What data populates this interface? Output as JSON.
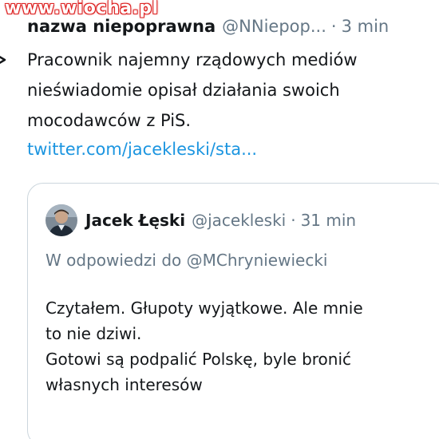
{
  "watermark": {
    "text": "www.wiocha.pl"
  },
  "tweet": {
    "author_name": "nazwa niepoprawna",
    "author_handle": "@NNiepop...",
    "separator": "·",
    "time": "3 min",
    "text_lines": [
      "Pracownik najemny rządowych mediów",
      "nieświadomie opisał działania swoich",
      "mocodawców z PiS."
    ],
    "link": "twitter.com/jacekleski/sta..."
  },
  "quoted_tweet": {
    "author_name": "Jacek Łęski",
    "author_handle": "@jacekleski",
    "separator": "·",
    "time": "31 min",
    "reply_to": "W odpowiedzi do @MChryniewiecki",
    "text_lines": [
      "Czytałem. Głupoty wyjątkowe. Ale mnie",
      "to nie dziwi.",
      "Gotowi są podpalić Polskę, byle bronić",
      "własnych interesów"
    ]
  },
  "colors": {
    "text": "#14171a",
    "secondary": "#657786",
    "link": "#1b95e0",
    "border": "#ccd6dd",
    "watermark_outline": "#dd2222"
  },
  "icons": {
    "left_edge": "chevron-icon",
    "avatar": "avatar-icon"
  }
}
